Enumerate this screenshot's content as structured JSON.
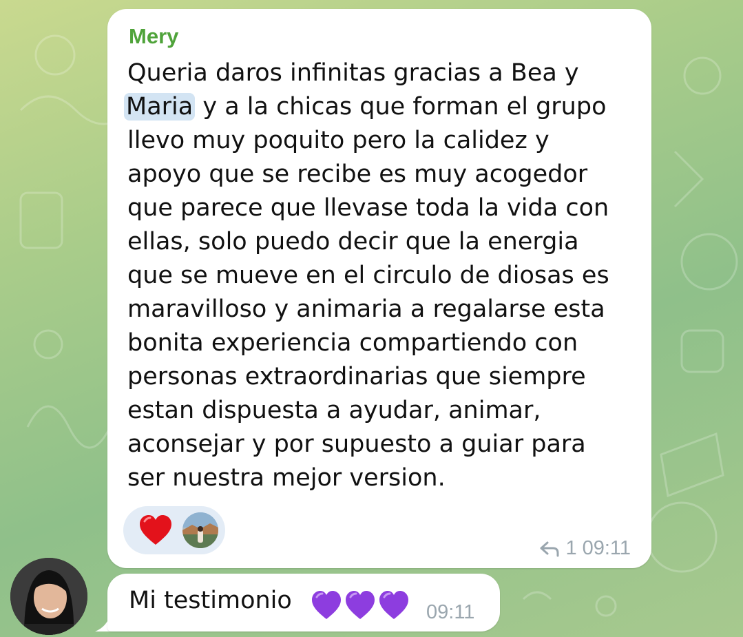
{
  "message1": {
    "sender": "Mery",
    "lines": [
      "Queria daros infinitas gracias a Bea y",
      "y a la chicas que forman el grupo",
      "llevo muy poquito pero la calidez y",
      "apoyo que se recibe es muy acogedor",
      "que parece que llevase toda la vida con",
      "ellas, solo puedo decir que la energia",
      "que se mueve en el circulo de diosas es",
      "maravilloso y animaria a regalarse esta",
      "bonita experiencia compartiendo con",
      "personas extraordinarias que siempre",
      "estan dispuesta a ayudar, animar,",
      "aconsejar y por supuesto a guiar para",
      "ser nuestra mejor version."
    ],
    "mention": "Maria",
    "reactions": [
      "heart",
      "user-avatar"
    ],
    "reply_count": "1",
    "time": "09:11"
  },
  "message2": {
    "text": "Mi testimonio",
    "emoji": "purple-hearts",
    "time": "09:11"
  },
  "colors": {
    "sender_name": "#4fa33a",
    "bubble": "#ffffff",
    "mention_bg": "#d3e4f3",
    "meta_text": "#9aa6ae"
  }
}
